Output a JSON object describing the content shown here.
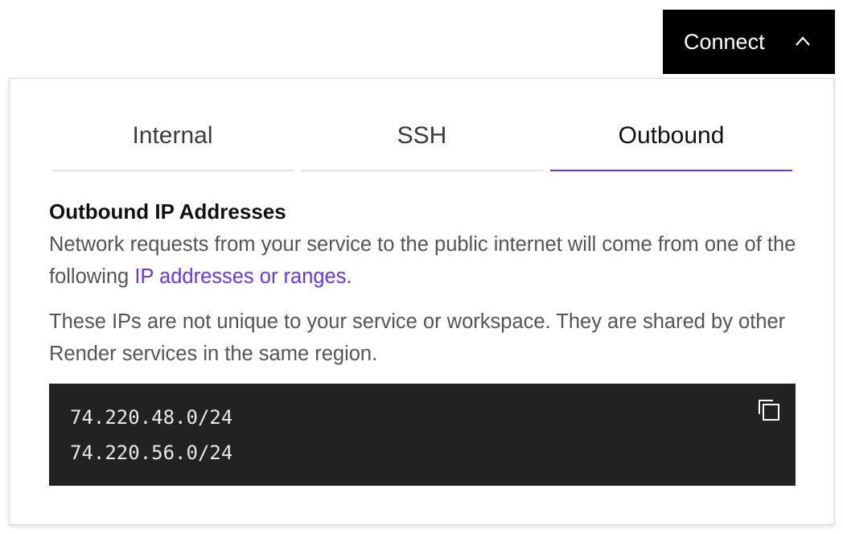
{
  "connect": {
    "label": "Connect",
    "icon": "chevron-up-icon"
  },
  "tabs": [
    {
      "label": "Internal",
      "active": false
    },
    {
      "label": "SSH",
      "active": false
    },
    {
      "label": "Outbound",
      "active": true
    }
  ],
  "outbound": {
    "title": "Outbound IP Addresses",
    "description_prefix": "Network requests from your service to the public internet will come from one of the following ",
    "description_link": "IP addresses or ranges.",
    "note": "These IPs are not unique to your service or workspace. They are shared by other Render services in the same region.",
    "ips": [
      "74.220.48.0/24",
      "74.220.56.0/24"
    ],
    "copy_icon": "copy-icon"
  },
  "colors": {
    "accent": "#6a35f0",
    "code_bg": "#222222",
    "button_bg": "#000000"
  }
}
